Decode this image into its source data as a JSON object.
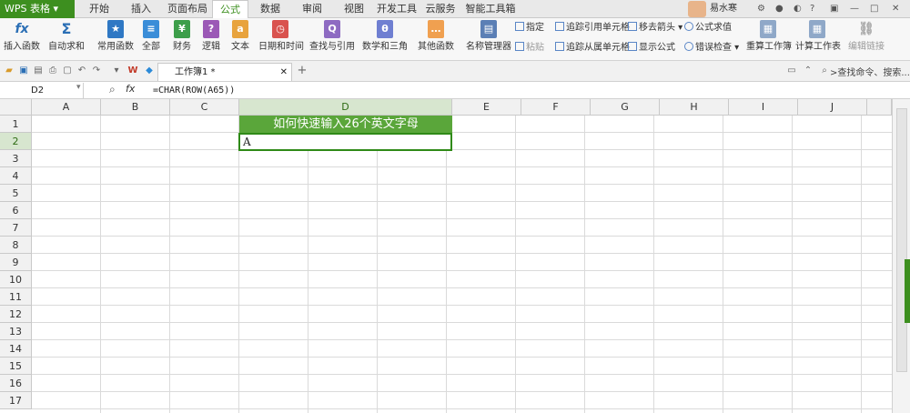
{
  "app": {
    "name": "WPS 表格",
    "user": "易水寒"
  },
  "menu_tabs": [
    "开始",
    "插入",
    "页面布局",
    "公式",
    "数据",
    "审阅",
    "视图",
    "开发工具",
    "云服务",
    "智能工具箱"
  ],
  "active_tab": "公式",
  "ribbon": {
    "large_buttons": [
      "插入函数",
      "自动求和",
      "常用函数",
      "全部",
      "财务",
      "逻辑",
      "文本",
      "日期和时间",
      "查找与引用",
      "数学和三角",
      "其他函数",
      "名称管理器"
    ],
    "small_buttons": [
      "指定",
      "粘贴",
      "追踪引用单元格",
      "追踪从属单元格",
      "移去箭头",
      "显示公式",
      "公式求值",
      "错误检查"
    ],
    "calc_buttons": [
      "重算工作簿",
      "计算工作表"
    ],
    "edit_links": "编辑链接"
  },
  "quickbar": {
    "doc_tab": "工作簿1 *",
    "search_placeholder": ">查找命令、搜索..."
  },
  "formula_bar": {
    "name_box": "D2",
    "fx": "fx",
    "formula": "=CHAR(ROW(A65))"
  },
  "sheet": {
    "columns": [
      "A",
      "B",
      "C",
      "D",
      "E",
      "F",
      "G",
      "H",
      "I",
      "J"
    ],
    "rows": [
      "1",
      "2",
      "3",
      "4",
      "5",
      "6",
      "7",
      "8",
      "9",
      "10",
      "11",
      "12",
      "13",
      "14",
      "15",
      "16",
      "17"
    ],
    "selected_column": "D",
    "selected_row": "2",
    "cells": {
      "D1": "如何快速输入26个英文字母",
      "D2": "A"
    },
    "accent_color": "#5aa63a"
  }
}
